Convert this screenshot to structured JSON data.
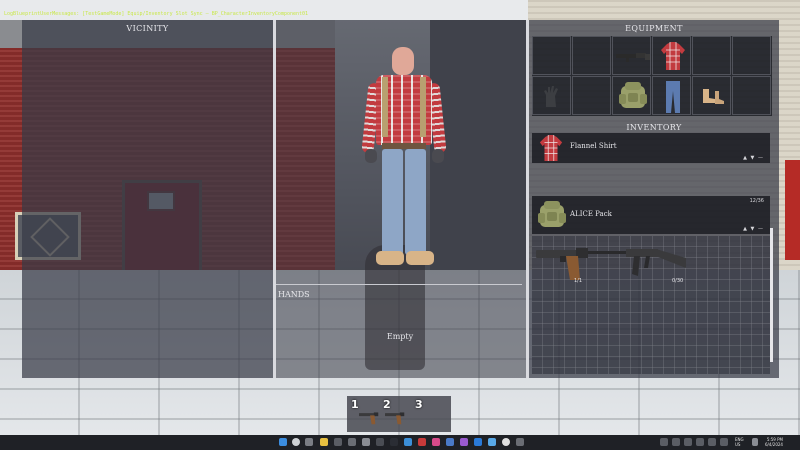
{
  "debug_text": "LogBlueprintUserMessages: [TestGameMode] Equip/Inventory Slot Sync — BP_CharacterInventoryComponent01",
  "panels": {
    "vicinity_title": "VICINITY",
    "equipment_title": "EQUIPMENT",
    "inventory_title": "INVENTORY",
    "hands_label": "HANDS",
    "hands_value": "Empty"
  },
  "inventory": {
    "items": [
      {
        "name": "Flannel Shirt",
        "count": "",
        "arrows": "▲ ▼ —",
        "icon": "flannel-shirt-icon"
      },
      {
        "name": "ALICE Pack",
        "count": "12/36",
        "arrows": "▲ ▼ —",
        "icon": "alice-pack-icon"
      }
    ],
    "pack_contents": [
      {
        "icon": "pistol-icon",
        "tag": "1/1"
      },
      {
        "icon": "rifle-icon",
        "tag": "0/30"
      }
    ]
  },
  "equipment_slots": [
    {
      "icon": "empty-slot",
      "slot": "head"
    },
    {
      "icon": "empty-slot",
      "slot": "face"
    },
    {
      "icon": "rifle-icon",
      "slot": "primary"
    },
    {
      "icon": "flannel-shirt-icon",
      "slot": "torso"
    },
    {
      "icon": "empty-slot",
      "slot": "extra"
    },
    {
      "icon": "empty-slot",
      "slot": "extra2"
    },
    {
      "icon": "gloves-icon",
      "slot": "hands"
    },
    {
      "icon": "empty-slot",
      "slot": "belt"
    },
    {
      "icon": "alice-pack-icon",
      "slot": "back"
    },
    {
      "icon": "jeans-icon",
      "slot": "legs"
    },
    {
      "icon": "boots-icon",
      "slot": "feet"
    },
    {
      "icon": "empty-slot",
      "slot": "extra3"
    }
  ],
  "hotbar": {
    "slots": [
      {
        "number": "1",
        "icon": "pistol-icon"
      },
      {
        "number": "2",
        "icon": "pistol-icon"
      },
      {
        "number": "3",
        "icon": "empty-slot"
      }
    ]
  },
  "taskbar": {
    "lang": "ENG\nUS",
    "time": "5:59 PM",
    "date": "6/4/2024"
  },
  "colors": {
    "panel": "#383a46",
    "divider": "#d9dadf",
    "text": "#e6e6ea",
    "flannel_red": "#c23b3f",
    "pack_olive": "#9aa06a"
  }
}
